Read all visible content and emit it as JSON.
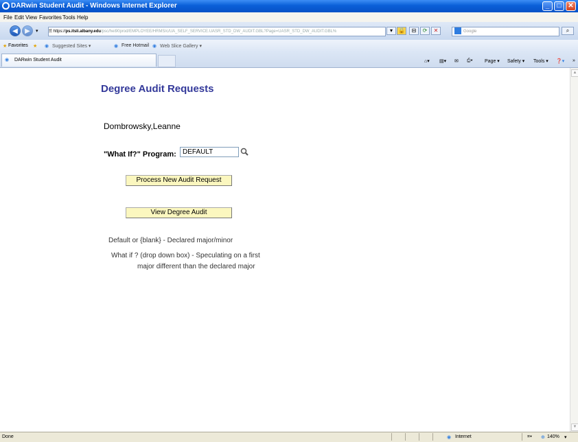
{
  "window": {
    "title": "DARwin Student Audit - Windows Internet Explorer"
  },
  "menu": [
    "File",
    "Edit",
    "View",
    "Favorites",
    "Tools",
    "Help"
  ],
  "address": {
    "scheme": "https://",
    "host": "ps.itsli.albany.edu",
    "path": "/psc/hei90prod/EMPLOYEE/HRMS/c/UA_SELF_SERVICE.UASR_STD_DW_AUDIT.GBL?Page=UASR_STD_DW_AUDIT.GBL%"
  },
  "search_placeholder": "Google",
  "favorites": {
    "label": "Favorites",
    "items": [
      "Suggested Sites ▾",
      "Free Hotmail",
      "Web Slice Gallery ▾"
    ]
  },
  "tab": {
    "label": "DARwin Student Audit"
  },
  "command_bar": [
    "Page ▾",
    "Safety ▾",
    "Tools ▾"
  ],
  "page": {
    "heading": "Degree Audit Requests",
    "student_name": "Dombrowsky,Leanne",
    "whatif_label": "\"What If?\" Program:",
    "program_value": "DEFAULT",
    "process_button": "Process New Audit Request",
    "view_button": "View Degree Audit",
    "note1": "Default or {blank} - Declared major/minor",
    "note2_line1": "What if ? (drop down box) - Speculating on a first",
    "note2_line2": "major different than the declared major"
  },
  "status": {
    "left": "Done",
    "zone": "Internet",
    "zoom": "140%"
  }
}
